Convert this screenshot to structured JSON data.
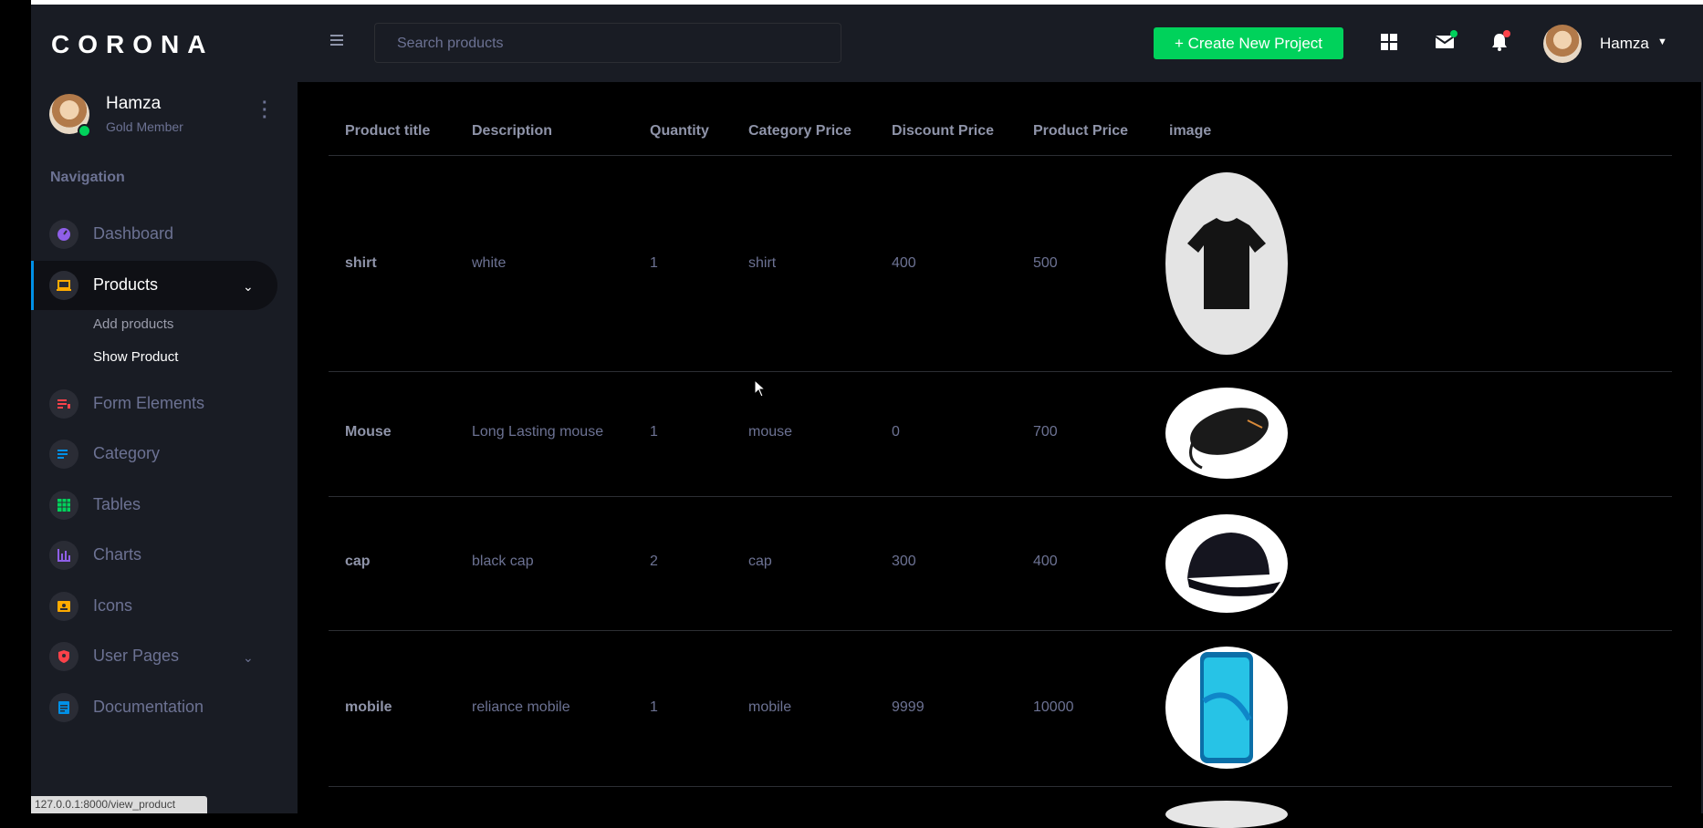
{
  "brand": "CORONA",
  "profile": {
    "name": "Hamza",
    "role": "Gold Member"
  },
  "nav": {
    "heading": "Navigation",
    "items": [
      {
        "label": "Dashboard",
        "icon": "speedometer-icon",
        "color": "#8f5fe8"
      },
      {
        "label": "Products",
        "icon": "laptop-icon",
        "color": "#ffab00"
      },
      {
        "label": "Form Elements",
        "icon": "playlist-icon",
        "color": "#fc424a"
      },
      {
        "label": "Category",
        "icon": "list-icon",
        "color": "#0090e7"
      },
      {
        "label": "Tables",
        "icon": "table-icon",
        "color": "#00d25b"
      },
      {
        "label": "Charts",
        "icon": "chart-bar-icon",
        "color": "#8f5fe8"
      },
      {
        "label": "Icons",
        "icon": "contacts-icon",
        "color": "#ffab00"
      },
      {
        "label": "User Pages",
        "icon": "security-icon",
        "color": "#fc424a"
      },
      {
        "label": "Documentation",
        "icon": "file-document-icon",
        "color": "#0090e7"
      }
    ],
    "products_sub": [
      "Add products",
      "Show Product"
    ]
  },
  "topbar": {
    "search_placeholder": "Search products",
    "create_label": "+ Create New Project",
    "user_name": "Hamza"
  },
  "table": {
    "headers": [
      "Product title",
      "Description",
      "Quantity",
      "Category Price",
      "Discount Price",
      "Product Price",
      "image"
    ],
    "rows": [
      {
        "title": "shirt",
        "description": "white",
        "quantity": "1",
        "category": "shirt",
        "discount": "400",
        "price": "500",
        "image": "tshirt"
      },
      {
        "title": "Mouse",
        "description": "Long Lasting mouse",
        "quantity": "1",
        "category": "mouse",
        "discount": "0",
        "price": "700",
        "image": "mouse"
      },
      {
        "title": "cap",
        "description": "black cap",
        "quantity": "2",
        "category": "cap",
        "discount": "300",
        "price": "400",
        "image": "cap"
      },
      {
        "title": "mobile",
        "description": "reliance mobile",
        "quantity": "1",
        "category": "mobile",
        "discount": "9999",
        "price": "10000",
        "image": "phone"
      }
    ]
  },
  "status_url": "127.0.0.1:8000/view_product"
}
